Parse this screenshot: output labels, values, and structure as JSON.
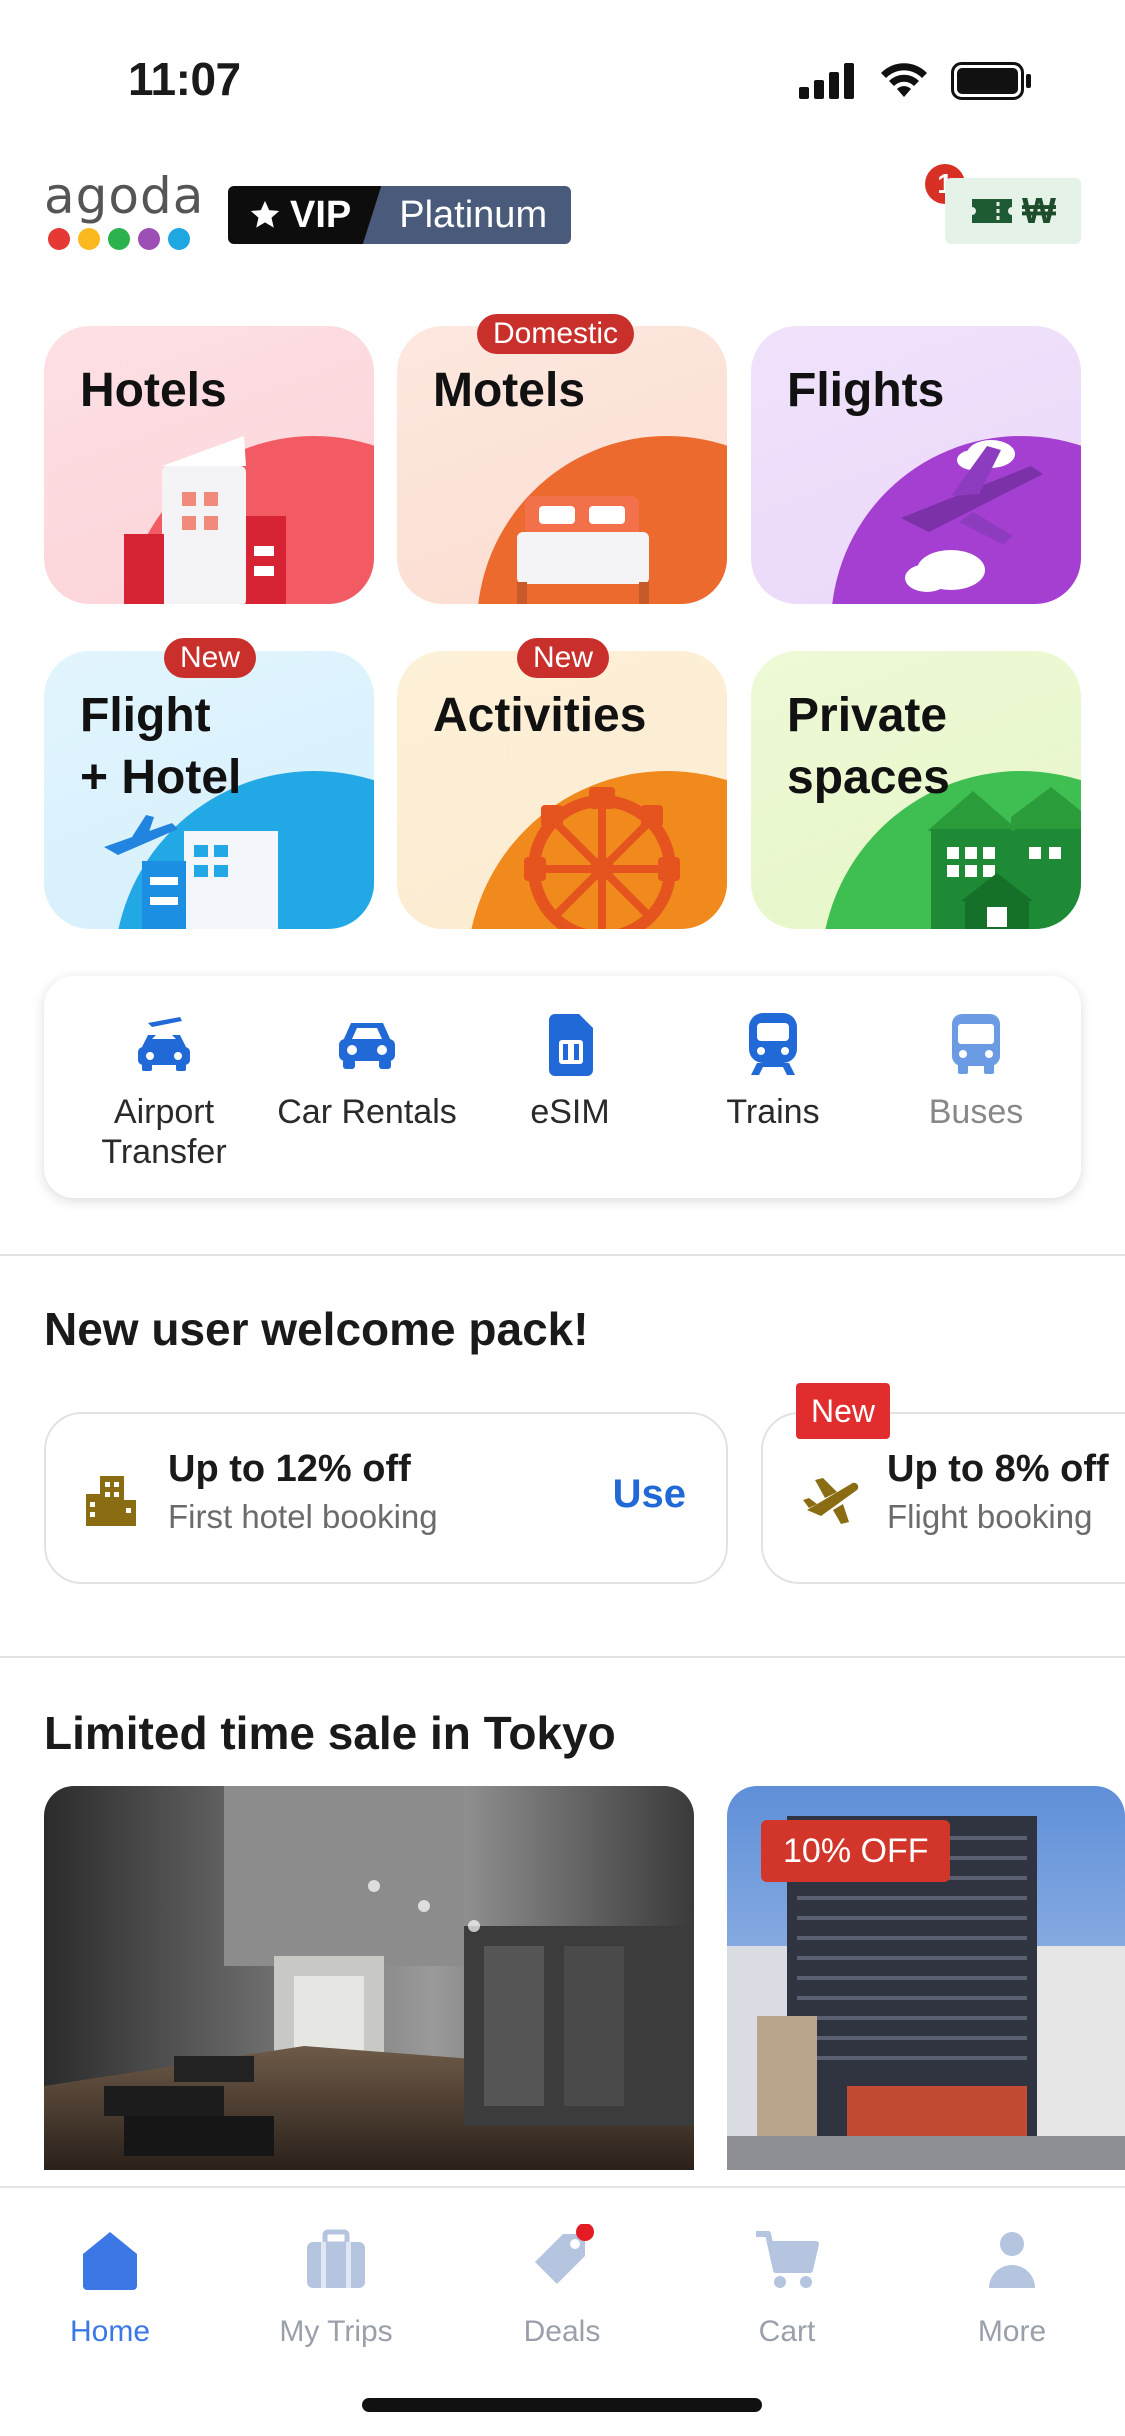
{
  "status_bar": {
    "time": "11:07"
  },
  "header": {
    "logo_text": "agoda",
    "logo_dot_colors": [
      "#e53935",
      "#fbb81f",
      "#2bb24c",
      "#9c4fb5",
      "#1ea7e1"
    ],
    "vip_label": "VIP",
    "tier_label": "Platinum",
    "wallet_count": "1",
    "wallet_currency": "₩"
  },
  "categories": [
    {
      "label": "Hotels",
      "tag": ""
    },
    {
      "label": "Motels",
      "tag": "Domestic"
    },
    {
      "label": "Flights",
      "tag": ""
    },
    {
      "label_line1": "Flight",
      "label_line2": "+ Hotel",
      "tag": "New"
    },
    {
      "label": "Activities",
      "tag": "New"
    },
    {
      "label_line1": "Private",
      "label_line2": "spaces",
      "tag": ""
    }
  ],
  "services": [
    {
      "line1": "Airport",
      "line2": "Transfer",
      "icon": "airport-transfer-icon"
    },
    {
      "line1": "Car Rentals",
      "icon": "car-icon"
    },
    {
      "line1": "eSIM",
      "icon": "esim-icon"
    },
    {
      "line1": "Trains",
      "icon": "train-icon"
    },
    {
      "line1": "Buses",
      "icon": "bus-icon"
    }
  ],
  "welcome": {
    "title": "New user welcome pack!",
    "offers": [
      {
        "title": "Up to 12% off",
        "subtitle": "First hotel booking",
        "action": "Use",
        "icon": "hotel-building-icon"
      },
      {
        "title": "Up to 8% off",
        "subtitle": "Flight booking",
        "badge": "New",
        "icon": "airplane-icon"
      }
    ]
  },
  "sale": {
    "title": "Limited time sale in Tokyo",
    "cards": [
      {
        "badge": ""
      },
      {
        "badge": "10% OFF"
      }
    ]
  },
  "bottom_nav": [
    {
      "label": "Home",
      "active": true,
      "icon": "home-icon"
    },
    {
      "label": "My Trips",
      "icon": "briefcase-icon"
    },
    {
      "label": "Deals",
      "icon": "tag-icon"
    },
    {
      "label": "Cart",
      "icon": "cart-icon"
    },
    {
      "label": "More",
      "icon": "person-icon"
    }
  ],
  "colors": {
    "accent_blue": "#2169d6",
    "badge_red": "#c9302c",
    "nav_active": "#3b78e6",
    "nav_inactive": "#9aa0ab"
  }
}
